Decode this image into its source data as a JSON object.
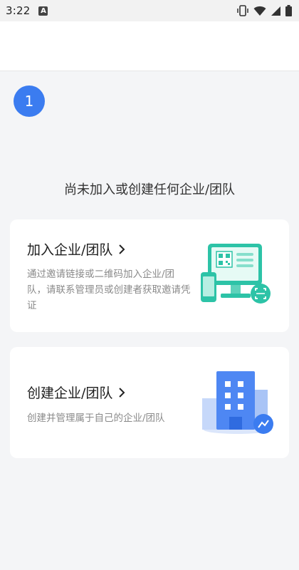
{
  "status_bar": {
    "time": "3:22",
    "notification_icon": "a-icon"
  },
  "step": {
    "number": "1"
  },
  "empty_state": {
    "title": "尚未加入或创建任何企业/团队"
  },
  "join_card": {
    "title": "加入企业/团队",
    "description": "通过邀请链接或二维码加入企业/团队，请联系管理员或创建者获取邀请凭证",
    "icon": "qr-computer-illustration"
  },
  "create_card": {
    "title": "创建企业/团队",
    "description": "创建并管理属于自己的企业/团队",
    "icon": "building-illustration"
  },
  "colors": {
    "accent": "#3b7cf0",
    "teal": "#2dc3a7",
    "background": "#f4f5f7"
  }
}
